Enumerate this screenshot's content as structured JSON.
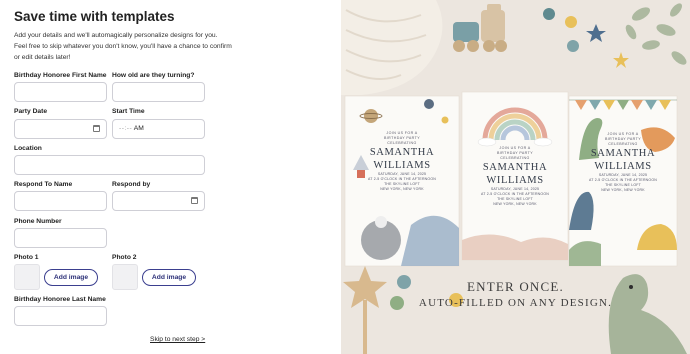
{
  "form": {
    "title": "Save time with templates",
    "intro": "Add your details and we'll automagically personalize designs for you. Feel free to skip whatever you don't know, you'll have a chance to confirm or edit details later!",
    "labels": {
      "honoree_first": "Birthday Honoree First Name",
      "age": "How old are they turning?",
      "party_date": "Party Date",
      "start_time": "Start Time",
      "location": "Location",
      "respond_to": "Respond To Name",
      "respond_by": "Respond by",
      "phone": "Phone Number",
      "photo1": "Photo 1",
      "photo2": "Photo 2",
      "honoree_last": "Birthday Honoree Last Name"
    },
    "start_time": {
      "placeholder": "--:--",
      "ampm": "AM"
    },
    "add_image_label": "Add image",
    "skip_label": "Skip to next step >"
  },
  "promo": {
    "cards": [
      {
        "line1": "JOIN US FOR A",
        "line2": "BIRTHDAY PARTY",
        "line3": "CELEBRATING",
        "name1": "SAMANTHA",
        "name2": "WILLIAMS",
        "date": "SATURDAY, JUNE 14, 2025",
        "time": "AT 2-5 O'CLOCK IN THE AFTERNOON",
        "venue": "THE SKYLINE LOFT",
        "city": "NEW YORK, NEW YORK"
      },
      {
        "line1": "JOIN US FOR A",
        "line2": "BIRTHDAY PARTY",
        "line3": "CELEBRATING",
        "name1": "SAMANTHA",
        "name2": "WILLIAMS",
        "date": "SATURDAY, JUNE 14, 2025",
        "time": "AT 2-5 O'CLOCK IN THE AFTERNOON",
        "venue": "THE SKYLINE LOFT",
        "city": "NEW YORK, NEW YORK"
      },
      {
        "line1": "JOIN US FOR A",
        "line2": "BIRTHDAY PARTY",
        "line3": "CELEBRATING",
        "name1": "SAMANTHA",
        "name2": "WILLIAMS",
        "date": "SATURDAY, JUNE 14, 2025",
        "time": "AT 2-5 O'CLOCK IN THE AFTERNOON",
        "venue": "THE SKYLINE LOFT",
        "city": "NEW YORK, NEW YORK"
      }
    ],
    "tagline1": "ENTER ONCE.",
    "tagline2": "AUTO-FILLED ON ANY DESIGN."
  },
  "colors": {
    "accent": "#3b3f8f",
    "field_border": "#cfcfd6",
    "photo_bg": "#f1f1f3",
    "promo_bg": "#ece6df"
  },
  "icons": [
    "calendar-icon",
    "rocket-icon",
    "planet-icon",
    "rainbow-icon",
    "dinosaur-icon",
    "star-icon",
    "toy-train-icon"
  ]
}
